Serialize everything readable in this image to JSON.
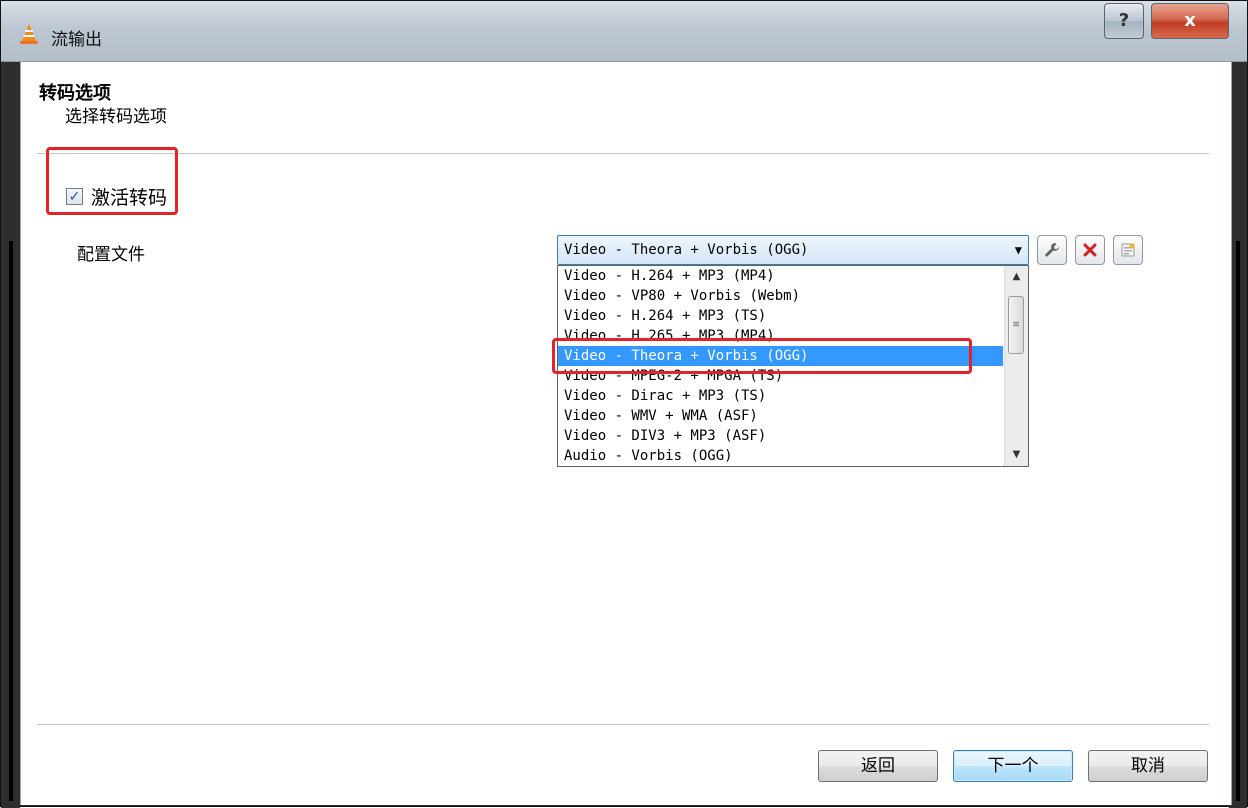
{
  "window": {
    "title": "流输出",
    "help_glyph": "?",
    "close_glyph": "x"
  },
  "header": {
    "title": "转码选项",
    "subtitle": "选择转码选项"
  },
  "transcode": {
    "checkbox_label": "激活转码",
    "checked": true,
    "check_glyph": "✓"
  },
  "profile": {
    "label": "配置文件",
    "selected": "Video - Theora + Vorbis (OGG)",
    "options": [
      "Video - H.264 + MP3 (MP4)",
      "Video - VP80 + Vorbis (Webm)",
      "Video - H.264 + MP3 (TS)",
      "Video - H.265 + MP3 (MP4)",
      "Video - Theora + Vorbis (OGG)",
      "Video - MPEG-2 + MPGA (TS)",
      "Video - Dirac + MP3 (TS)",
      "Video - WMV + WMA (ASF)",
      "Video - DIV3 + MP3 (ASF)",
      "Audio - Vorbis (OGG)"
    ],
    "selected_index": 4,
    "icons": {
      "edit": "wrench-icon",
      "delete": "delete-x-icon",
      "new": "new-profile-icon"
    }
  },
  "footer": {
    "back_label": "返回",
    "next_label": "下一个",
    "cancel_label": "取消"
  },
  "colors": {
    "highlight": "#e0242a",
    "selection": "#3399ff",
    "delete_red": "#d42020"
  }
}
